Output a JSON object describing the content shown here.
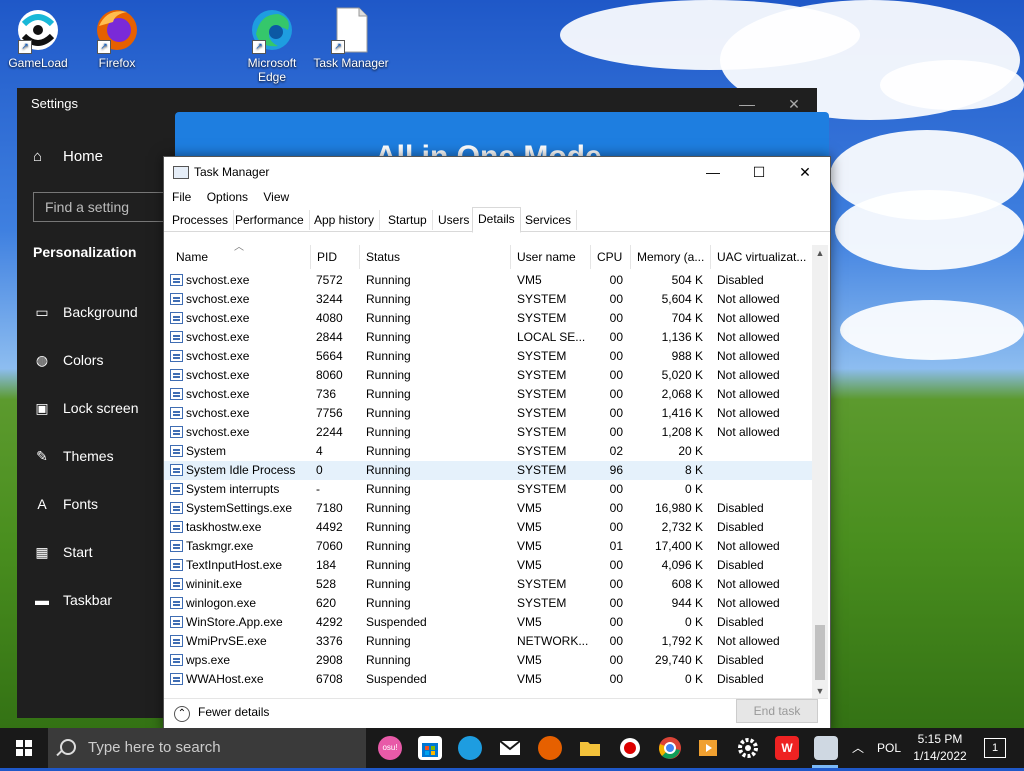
{
  "desktop": {
    "icons": [
      {
        "label": "GameLoad"
      },
      {
        "label": "Firefox"
      },
      {
        "label": "Microsoft Edge"
      },
      {
        "label": "Task Manager"
      }
    ]
  },
  "settings": {
    "title": "Settings",
    "home": "Home",
    "search_placeholder": "Find a setting",
    "section": "Personalization",
    "nav": [
      {
        "label": "Background",
        "icon": "image-icon"
      },
      {
        "label": "Colors",
        "icon": "palette-icon"
      },
      {
        "label": "Lock screen",
        "icon": "lock-screen-icon"
      },
      {
        "label": "Themes",
        "icon": "brush-icon"
      },
      {
        "label": "Fonts",
        "icon": "font-icon"
      },
      {
        "label": "Start",
        "icon": "start-icon"
      },
      {
        "label": "Taskbar",
        "icon": "taskbar-icon"
      }
    ],
    "banner": "All in One Mode"
  },
  "taskmanager": {
    "title": "Task Manager",
    "menu": [
      "File",
      "Options",
      "View"
    ],
    "tabs": [
      "Processes",
      "Performance",
      "App history",
      "Startup",
      "Users",
      "Details",
      "Services"
    ],
    "active_tab": "Details",
    "columns": [
      "Name",
      "PID",
      "Status",
      "User name",
      "CPU",
      "Memory (a...",
      "UAC virtualizat..."
    ],
    "rows": [
      {
        "name": "svchost.exe",
        "pid": "7572",
        "status": "Running",
        "user": "VM5",
        "cpu": "00",
        "mem": "504 K",
        "uac": "Disabled"
      },
      {
        "name": "svchost.exe",
        "pid": "3244",
        "status": "Running",
        "user": "SYSTEM",
        "cpu": "00",
        "mem": "5,604 K",
        "uac": "Not allowed"
      },
      {
        "name": "svchost.exe",
        "pid": "4080",
        "status": "Running",
        "user": "SYSTEM",
        "cpu": "00",
        "mem": "704 K",
        "uac": "Not allowed"
      },
      {
        "name": "svchost.exe",
        "pid": "2844",
        "status": "Running",
        "user": "LOCAL SE...",
        "cpu": "00",
        "mem": "1,136 K",
        "uac": "Not allowed"
      },
      {
        "name": "svchost.exe",
        "pid": "5664",
        "status": "Running",
        "user": "SYSTEM",
        "cpu": "00",
        "mem": "988 K",
        "uac": "Not allowed"
      },
      {
        "name": "svchost.exe",
        "pid": "8060",
        "status": "Running",
        "user": "SYSTEM",
        "cpu": "00",
        "mem": "5,020 K",
        "uac": "Not allowed"
      },
      {
        "name": "svchost.exe",
        "pid": "736",
        "status": "Running",
        "user": "SYSTEM",
        "cpu": "00",
        "mem": "2,068 K",
        "uac": "Not allowed"
      },
      {
        "name": "svchost.exe",
        "pid": "7756",
        "status": "Running",
        "user": "SYSTEM",
        "cpu": "00",
        "mem": "1,416 K",
        "uac": "Not allowed"
      },
      {
        "name": "svchost.exe",
        "pid": "2244",
        "status": "Running",
        "user": "SYSTEM",
        "cpu": "00",
        "mem": "1,208 K",
        "uac": "Not allowed"
      },
      {
        "name": "System",
        "pid": "4",
        "status": "Running",
        "user": "SYSTEM",
        "cpu": "02",
        "mem": "20 K",
        "uac": ""
      },
      {
        "name": "System Idle Process",
        "pid": "0",
        "status": "Running",
        "user": "SYSTEM",
        "cpu": "96",
        "mem": "8 K",
        "uac": "",
        "selected": true
      },
      {
        "name": "System interrupts",
        "pid": "-",
        "status": "Running",
        "user": "SYSTEM",
        "cpu": "00",
        "mem": "0 K",
        "uac": ""
      },
      {
        "name": "SystemSettings.exe",
        "pid": "7180",
        "status": "Running",
        "user": "VM5",
        "cpu": "00",
        "mem": "16,980 K",
        "uac": "Disabled"
      },
      {
        "name": "taskhostw.exe",
        "pid": "4492",
        "status": "Running",
        "user": "VM5",
        "cpu": "00",
        "mem": "2,732 K",
        "uac": "Disabled"
      },
      {
        "name": "Taskmgr.exe",
        "pid": "7060",
        "status": "Running",
        "user": "VM5",
        "cpu": "01",
        "mem": "17,400 K",
        "uac": "Not allowed"
      },
      {
        "name": "TextInputHost.exe",
        "pid": "184",
        "status": "Running",
        "user": "VM5",
        "cpu": "00",
        "mem": "4,096 K",
        "uac": "Disabled"
      },
      {
        "name": "wininit.exe",
        "pid": "528",
        "status": "Running",
        "user": "SYSTEM",
        "cpu": "00",
        "mem": "608 K",
        "uac": "Not allowed"
      },
      {
        "name": "winlogon.exe",
        "pid": "620",
        "status": "Running",
        "user": "SYSTEM",
        "cpu": "00",
        "mem": "944 K",
        "uac": "Not allowed"
      },
      {
        "name": "WinStore.App.exe",
        "pid": "4292",
        "status": "Suspended",
        "user": "VM5",
        "cpu": "00",
        "mem": "0 K",
        "uac": "Disabled"
      },
      {
        "name": "WmiPrvSE.exe",
        "pid": "3376",
        "status": "Running",
        "user": "NETWORK...",
        "cpu": "00",
        "mem": "1,792 K",
        "uac": "Not allowed"
      },
      {
        "name": "wps.exe",
        "pid": "2908",
        "status": "Running",
        "user": "VM5",
        "cpu": "00",
        "mem": "29,740 K",
        "uac": "Disabled"
      },
      {
        "name": "WWAHost.exe",
        "pid": "6708",
        "status": "Suspended",
        "user": "VM5",
        "cpu": "00",
        "mem": "0 K",
        "uac": "Disabled"
      }
    ],
    "fewer_details": "Fewer details",
    "end_task": "End task"
  },
  "taskbar": {
    "search_placeholder": "Type here to search",
    "avatar_text": "osu!",
    "language": "POL",
    "time": "5:15 PM",
    "date": "1/14/2022",
    "notification_count": "1"
  }
}
